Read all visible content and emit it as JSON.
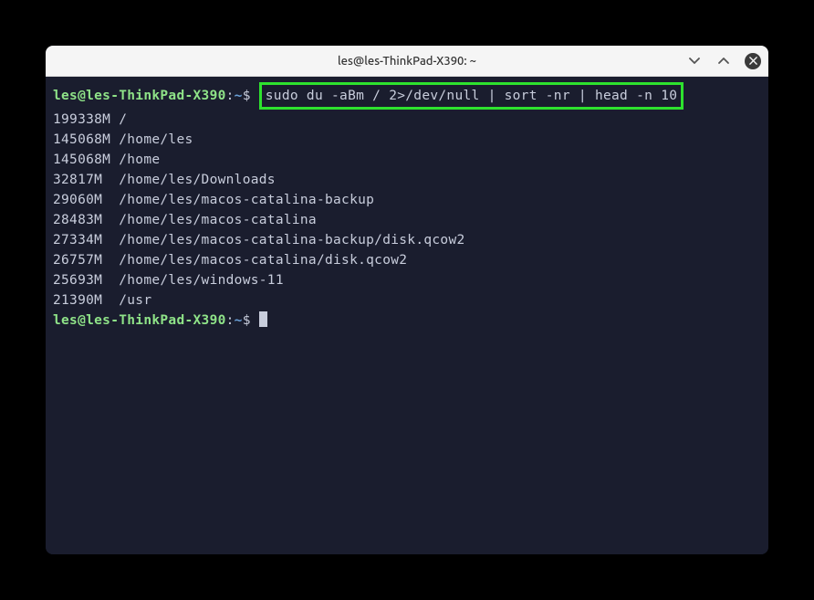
{
  "window": {
    "title": "les@les-ThinkPad-X390: ~"
  },
  "prompt": {
    "user": "les",
    "at": "@",
    "host": "les-ThinkPad-X390",
    "colon": ":",
    "path": "~",
    "symbol": "$"
  },
  "command": "sudo du -aBm / 2>/dev/null | sort -nr | head -n 10",
  "output": [
    {
      "size": "199338M",
      "path": "/"
    },
    {
      "size": "145068M",
      "path": "/home/les"
    },
    {
      "size": "145068M",
      "path": "/home"
    },
    {
      "size": "32817M",
      "path": "/home/les/Downloads"
    },
    {
      "size": "29060M",
      "path": "/home/les/macos-catalina-backup"
    },
    {
      "size": "28483M",
      "path": "/home/les/macos-catalina"
    },
    {
      "size": "27334M",
      "path": "/home/les/macos-catalina-backup/disk.qcow2"
    },
    {
      "size": "26757M",
      "path": "/home/les/macos-catalina/disk.qcow2"
    },
    {
      "size": "25693M",
      "path": "/home/les/windows-11"
    },
    {
      "size": "21390M",
      "path": "/usr"
    }
  ]
}
